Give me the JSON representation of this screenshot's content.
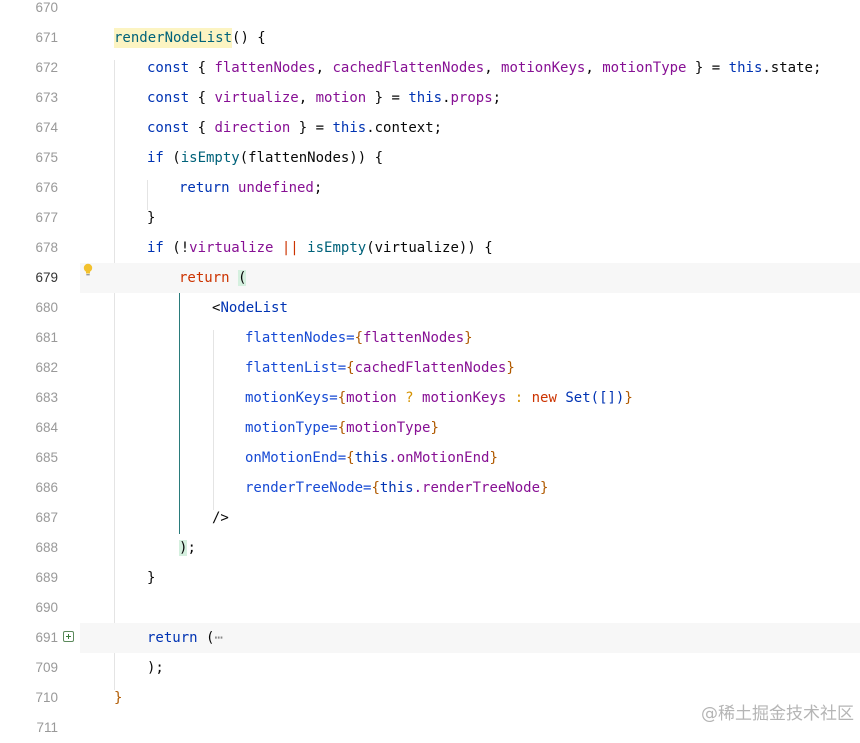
{
  "line_numbers": [
    "670",
    "671",
    "672",
    "673",
    "674",
    "675",
    "676",
    "677",
    "678",
    "679",
    "680",
    "681",
    "682",
    "683",
    "684",
    "685",
    "686",
    "687",
    "688",
    "689",
    "690",
    "691",
    "709",
    "710",
    "711"
  ],
  "code": {
    "l671": {
      "fn": "renderNodeList",
      "rest": "() {"
    },
    "l672": {
      "const": "const",
      "open": " { ",
      "a": "flattenNodes",
      "c1": ", ",
      "b": "cachedFlattenNodes",
      "c2": ", ",
      "c": "motionKeys",
      "c3": ", ",
      "d": "motionType",
      "close": " } = ",
      "this": "this",
      "tail": ".state;"
    },
    "l673": {
      "const": "const",
      "open": " { ",
      "a": "virtualize",
      "c1": ", ",
      "b": "motion",
      "close": " } = ",
      "this": "this",
      "dot": ".",
      "props": "props",
      "semi": ";"
    },
    "l674": {
      "const": "const",
      "open": " { ",
      "a": "direction",
      "close": " } = ",
      "this": "this",
      "tail": ".context;"
    },
    "l675": {
      "if": "if",
      "open": " (",
      "fn": "isEmpty",
      "arg": "(flattenNodes)) {"
    },
    "l676": {
      "ret": "return",
      "val": " undefined",
      "semi": ";"
    },
    "l677": {
      "text": "}"
    },
    "l678": {
      "if": "if",
      "open": " (!",
      "a": "virtualize",
      "op": " || ",
      "fn": "isEmpty",
      "arg": "(virtualize)) {"
    },
    "l679": {
      "ret": "return",
      "sp": " ",
      "paren": "("
    },
    "l680": {
      "lt": "<",
      "tag": "NodeList"
    },
    "l681": {
      "attr": "flattenNodes=",
      "ob": "{",
      "val": "flattenNodes",
      "cb": "}"
    },
    "l682": {
      "attr": "flattenList=",
      "ob": "{",
      "val": "cachedFlattenNodes",
      "cb": "}"
    },
    "l683": {
      "attr": "motionKeys=",
      "ob": "{",
      "a": "motion",
      "q": " ? ",
      "b": "motionKeys",
      "colon": " : ",
      "new": "new",
      "set": " Set([])",
      "cb": "}"
    },
    "l684": {
      "attr": "motionType=",
      "ob": "{",
      "val": "motionType",
      "cb": "}"
    },
    "l685": {
      "attr": "onMotionEnd=",
      "ob": "{",
      "this": "this",
      "val": ".onMotionEnd",
      "cb": "}"
    },
    "l686": {
      "attr": "renderTreeNode=",
      "ob": "{",
      "this": "this",
      "val": ".renderTreeNode",
      "cb": "}"
    },
    "l687": {
      "text": "/>"
    },
    "l688": {
      "paren": ")",
      "semi": ";"
    },
    "l689": {
      "text": "}"
    },
    "l691": {
      "ret": "return",
      "open": " (",
      "ell": "⋯"
    },
    "l709": {
      "text": ");"
    },
    "l710": {
      "text": "}"
    }
  },
  "icons": {
    "bulb": "lightbulb-icon",
    "fold": "expand-fold-icon"
  },
  "watermark": "@稀土掘金技术社区",
  "colors": {
    "keyword": "#0033b3",
    "variable": "#871094",
    "function": "#00627a",
    "brace": "#b05a00",
    "jsx_attr": "#174ad4",
    "gutter": "#999999",
    "current_line": "#f7f7f7"
  }
}
